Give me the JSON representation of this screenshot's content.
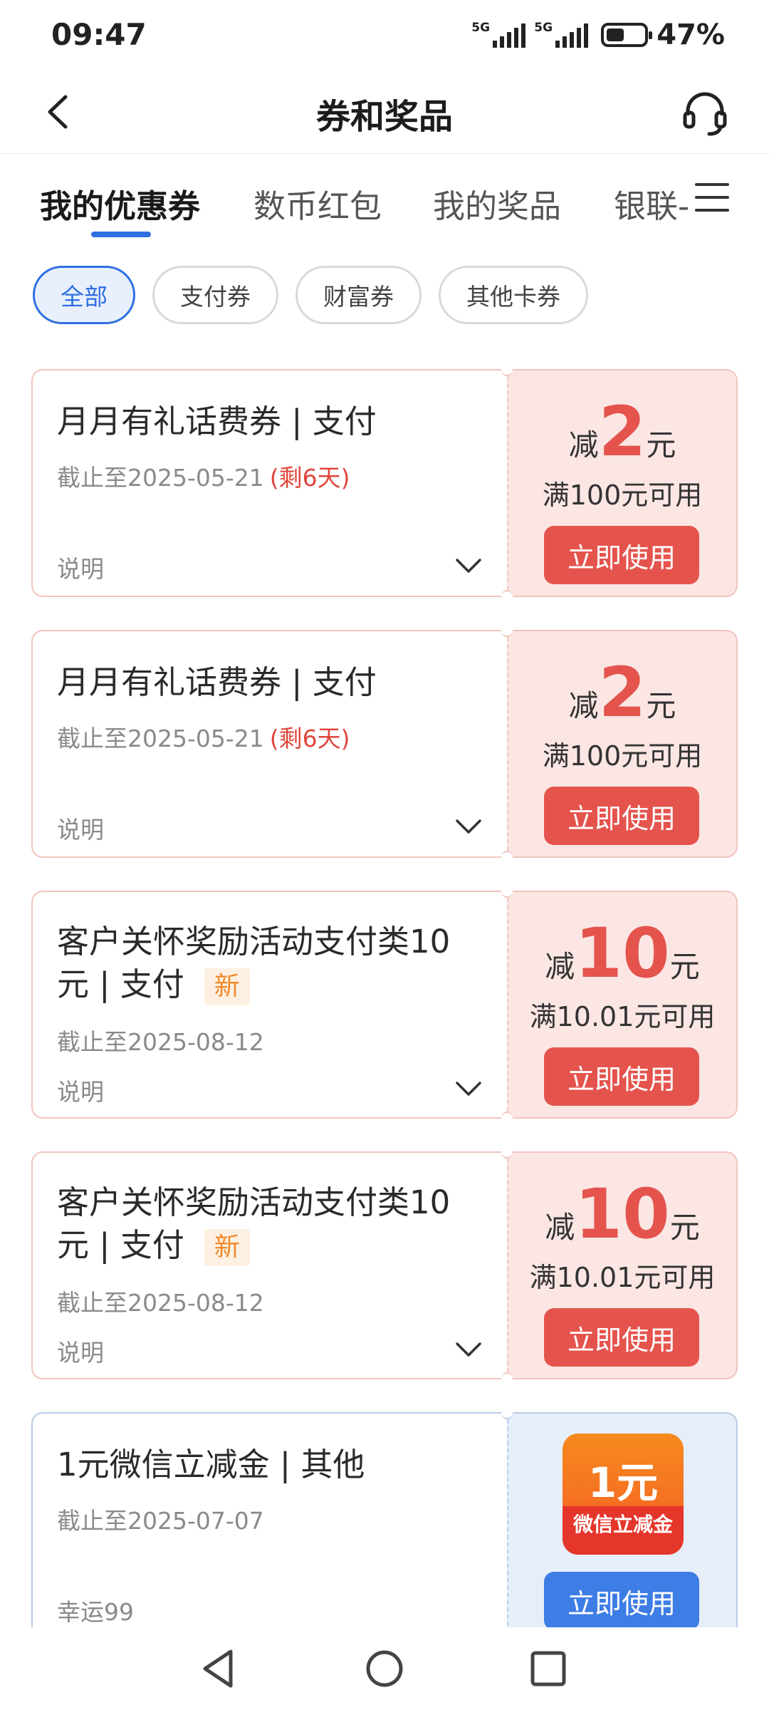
{
  "status_bar": {
    "time": "09:47",
    "signal1": "5G",
    "signal2": "5G",
    "battery_level": 0.47,
    "battery_text": "47%"
  },
  "header": {
    "title": "券和奖品",
    "back_icon": "chevron-left-icon",
    "service_icon": "headset-icon"
  },
  "tabs": [
    {
      "label": "我的优惠券",
      "active": true
    },
    {
      "label": "数币红包",
      "active": false
    },
    {
      "label": "我的奖品",
      "active": false
    },
    {
      "label": "银联-",
      "active": false
    }
  ],
  "menu_icon": "menu-icon",
  "filters": [
    {
      "label": "全部",
      "active": true
    },
    {
      "label": "支付券",
      "active": false
    },
    {
      "label": "财富券",
      "active": false
    },
    {
      "label": "其他卡券",
      "active": false
    }
  ],
  "coupons": [
    {
      "title": "月月有礼话费券 | 支付",
      "expiry": "截止至2025-05-21",
      "remaining": "(剩6天)",
      "desc": "说明",
      "prefix": "减",
      "amount": "2",
      "unit": "元",
      "condition": "满100元可用",
      "button": "立即使用"
    },
    {
      "title": "月月有礼话费券 | 支付",
      "expiry": "截止至2025-05-21",
      "remaining": "(剩6天)",
      "desc": "说明",
      "prefix": "减",
      "amount": "2",
      "unit": "元",
      "condition": "满100元可用",
      "button": "立即使用"
    },
    {
      "title_line1": "客户关怀奖励活动支付类10",
      "title_line2": "元 | 支付",
      "badge": "新",
      "expiry": "截止至2025-08-12",
      "desc": "说明",
      "prefix": "减",
      "amount": "10",
      "unit": "元",
      "condition": "满10.01元可用",
      "button": "立即使用"
    },
    {
      "title_line1": "客户关怀奖励活动支付类10",
      "title_line2": "元 | 支付",
      "badge": "新",
      "expiry": "截止至2025-08-12",
      "desc": "说明",
      "prefix": "减",
      "amount": "10",
      "unit": "元",
      "condition": "满10.01元可用",
      "button": "立即使用"
    },
    {
      "title": "1元微信立减金 | 其他",
      "expiry": "截止至2025-07-07",
      "desc": "幸运99",
      "tile_amount": "1元",
      "tile_label": "微信立减金",
      "button": "立即使用"
    }
  ],
  "nav_bar": {
    "back_icon": "triangle-back-icon",
    "home_icon": "circle-home-icon",
    "recents_icon": "square-recents-icon"
  },
  "colors": {
    "accent_blue": "#2f6fe0",
    "coupon_red": "#e4544d",
    "coupon_bg": "#fbe6e4",
    "badge_orange": "#f08a2a"
  }
}
